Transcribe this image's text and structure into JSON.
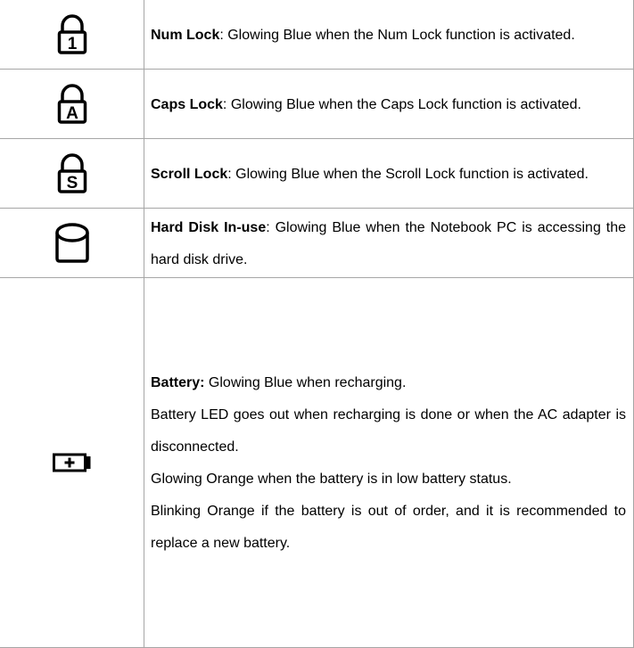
{
  "rows": [
    {
      "icon": "num-lock-icon",
      "icon_char": "1",
      "title": "Num Lock",
      "separator": ": ",
      "desc": "Glowing Blue when the Num Lock function is activated."
    },
    {
      "icon": "caps-lock-icon",
      "icon_char": "A",
      "title": "Caps Lock",
      "separator": ": ",
      "desc": "Glowing Blue when the Caps Lock function is activated."
    },
    {
      "icon": "scroll-lock-icon",
      "icon_char": "S",
      "title": "Scroll Lock",
      "separator": ": ",
      "desc": "Glowing Blue when the Scroll Lock function is activated."
    },
    {
      "icon": "hard-disk-icon",
      "title": "Hard Disk In-use",
      "separator": ": ",
      "desc": "Glowing Blue when the Notebook PC is accessing the hard disk drive."
    },
    {
      "icon": "battery-icon",
      "title": "Battery:",
      "separator": " ",
      "desc": "Glowing Blue when recharging.",
      "extra": [
        "Battery LED goes out when recharging is done or when the AC adapter is disconnected.",
        "Glowing Orange when the battery is in low battery status.",
        "Blinking Orange if the battery is out of order, and it is recommended to replace a new battery."
      ]
    }
  ]
}
